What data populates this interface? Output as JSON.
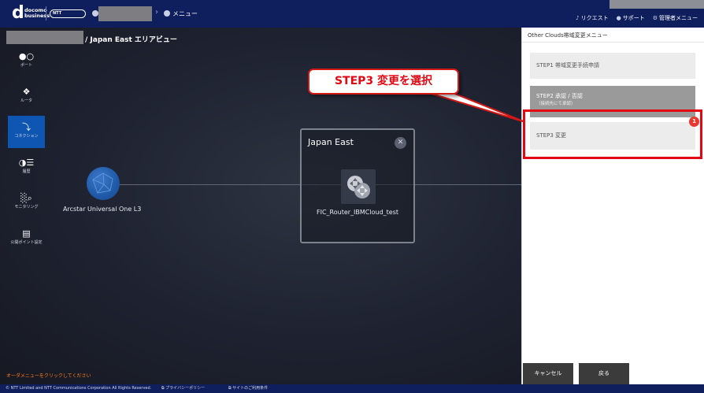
{
  "header": {
    "logo_text": "docomo\nbusiness",
    "ntt_logo_text": "NTT Communications",
    "crumb_menu": "メニュー",
    "links": [
      {
        "icon": "bell-icon",
        "glyph": "♪",
        "label": "リクエスト"
      },
      {
        "icon": "support-icon",
        "glyph": "●",
        "label": "サポート"
      },
      {
        "icon": "gear-icon",
        "glyph": "⚙",
        "label": "管理者メニュー"
      }
    ]
  },
  "canvas": {
    "area_title": "/ Japan East エリアビュー",
    "uo_label": "Arcstar Universal One L3",
    "region_title": "Japan East",
    "router_label": "FIC_Router_IBMCloud_test",
    "footer_message": "オーダメニューをクリックしてください"
  },
  "sidenav": {
    "items": [
      {
        "icon": "port-icon",
        "glyph": "●○",
        "label": "ポート",
        "active": false
      },
      {
        "icon": "router-icon",
        "glyph": "❖",
        "label": "ルータ",
        "active": false
      },
      {
        "icon": "connection-icon",
        "glyph": "⤵",
        "label": "コネクション",
        "active": true
      },
      {
        "icon": "history-icon",
        "glyph": "◑☰",
        "label": "履歴",
        "active": false
      },
      {
        "icon": "monitoring-icon",
        "glyph": "░⌕",
        "label": "モニタリング",
        "active": false
      },
      {
        "icon": "monitor-icon",
        "glyph": "▤",
        "label": "公開ポイント設定",
        "active": false
      }
    ]
  },
  "panel": {
    "title": "Other Clouds帯域変更メニュー",
    "step1": "STEP1 帯域変更手続申請",
    "step2": "STEP2 承認 / 否認",
    "step2_sub": "（接続先にて承認）",
    "step3": "STEP3 変更",
    "step3_badge": "1",
    "cancel": "キャンセル",
    "back": "戻る"
  },
  "annotation": {
    "callout": "STEP3 変更を選択"
  },
  "footer": {
    "copyright": "© NTT Limited and NTT Communications Corporation All Rights Reserved.",
    "privacy": "プライバシーポリシー",
    "terms": "サイトのご利用条件"
  },
  "colors": {
    "header": "#0f1e5c",
    "accent_active": "#0f56b3",
    "annotation_red": "#e30613",
    "footer_message": "#ff7a1a"
  }
}
